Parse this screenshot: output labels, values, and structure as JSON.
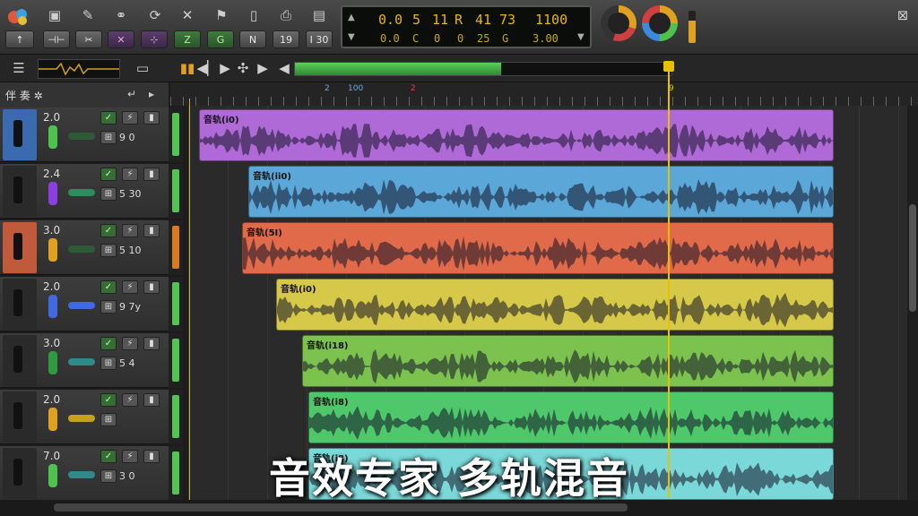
{
  "toolbar": {
    "up_label": "↑",
    "mode_labels": [
      "⊣⊢",
      "✂",
      "✕",
      "⊹",
      "Z",
      "G",
      "N",
      "19",
      "I 30"
    ],
    "lcd_top": [
      "0.0",
      "5",
      "11",
      "R",
      "41",
      "73",
      "1100"
    ],
    "lcd_bottom": [
      "0.0",
      "C",
      "0",
      "0",
      "25",
      "G",
      "3.00"
    ],
    "close_label": "⊠"
  },
  "header": {
    "track_header_label": "伴 奏 ✲"
  },
  "ruler": {
    "markers": [
      "2",
      "100",
      "2",
      "9"
    ]
  },
  "tracks": [
    {
      "name": "音轨(i0)",
      "volume": "2.0",
      "pan": "9 0",
      "color": "#b06ad8",
      "led": "#4ec24e",
      "slider": "#2f5a36",
      "meter": "#55c255"
    },
    {
      "name": "音轨(ii0)",
      "volume": "2.4",
      "pan": "5 30",
      "color": "#5aa7d8",
      "led": "#8b3fe0",
      "slider": "#2f8a5e",
      "meter": "#55c255"
    },
    {
      "name": "音轨(5I)",
      "volume": "3.0",
      "pan": "5 10",
      "color": "#e06a4a",
      "led": "#e0a020",
      "slider": "#2f5a36",
      "meter": "#d87a20"
    },
    {
      "name": "音轨(i0)",
      "volume": "2.0",
      "pan": "9 7y",
      "color": "#d6c848",
      "led": "#3f6ae0",
      "slider": "#3f6ae0",
      "meter": "#55c255"
    },
    {
      "name": "音轨(i18)",
      "volume": "3.0",
      "pan": "5 4",
      "color": "#7cc24e",
      "led": "#2f9a3f",
      "slider": "#2f8a8a",
      "meter": "#55c255"
    },
    {
      "name": "音轨(i8)",
      "volume": "2.0",
      "pan": "",
      "color": "#4ec86a",
      "led": "#e0a020",
      "slider": "#c8a020",
      "meter": "#55c255"
    },
    {
      "name": "音轨(i8)",
      "volume": "7.0",
      "pan": "3 0",
      "color": "#7ad8d8",
      "led": "#4ec24e",
      "slider": "#2f8a8a",
      "meter": "#55c255"
    }
  ],
  "overlay_text": "音效专家 多轨混音"
}
